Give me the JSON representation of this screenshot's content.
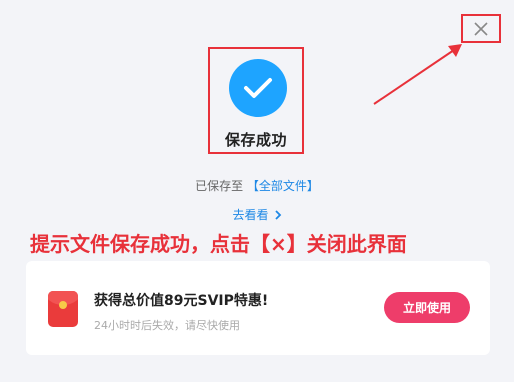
{
  "dialog": {
    "success_title": "保存成功",
    "saved_prefix": "已保存至",
    "saved_location": "【全部文件】",
    "goto_label": "去看看",
    "annotation": "提示文件保存成功，点击【×】关闭此界面"
  },
  "promo": {
    "title": "获得总价值89元SVIP特惠!",
    "subtitle": "24小时时后失效，请尽快使用",
    "button_label": "立即使用"
  },
  "colors": {
    "accent_blue": "#1ea4ff",
    "link_blue": "#1e88e5",
    "annotation_red": "#e8313a",
    "button_pink": "#ee3d6a"
  },
  "icons": {
    "close": "close-icon",
    "check": "check-icon",
    "chevron": "chevron-right-icon",
    "red_packet": "red-packet-icon"
  }
}
